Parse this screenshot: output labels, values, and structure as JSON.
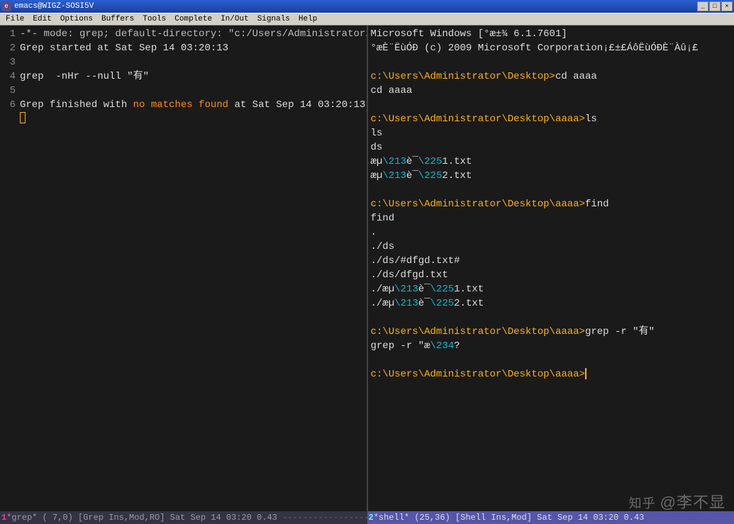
{
  "titlebar": {
    "title": "emacs@WIGZ-SOSI5V"
  },
  "menu": [
    "File",
    "Edit",
    "Options",
    "Buffers",
    "Tools",
    "Complete",
    "In/Out",
    "Signals",
    "Help"
  ],
  "left": {
    "l1": "-*- mode: grep; default-directory: \"c:/Users/Administrator/Desktop/aaaa/\" *",
    "l2": "Grep started at Sat Sep 14 03:20:13",
    "l4": "grep  -nHr --null \"有\"",
    "l6a": "Grep finished with ",
    "l6b": "no matches found",
    "l6c": " at Sat Sep 14 03:20:13"
  },
  "right": {
    "r1": "Microsoft Windows [°æ±¾ 6.1.7601]",
    "r2": "°æÈ¨ËùÓÐ (c) 2009 Microsoft Corporation¡£±£ÁôËùÓÐÈ¨Àû¡£",
    "p1": "c:\\Users\\Administrator\\Desktop>",
    "c1": "cd aaaa",
    "e1": "cd aaaa",
    "p2": "c:\\Users\\Administrator\\Desktop\\aaaa>",
    "c2": "ls",
    "ls1": "ls",
    "ls2": "ds",
    "ls3a": "æµ",
    "ls3b": "\\213",
    "ls3c": "è¯",
    "ls3d": "\\225",
    "ls3e": "1.txt",
    "ls4e": "2.txt",
    "c3": "find",
    "f1": "find",
    "f2": ".",
    "f3": "./ds",
    "f4": "./ds/#dfgd.txt#",
    "f5": "./ds/dfgd.txt",
    "f6a": "./æµ",
    "c4": "grep -r \"有\"",
    "g1a": "grep -r \"æ",
    "g1b": "\\234",
    "g1c": "?"
  },
  "modeline": {
    "left_num": "1",
    "left": "*grep* ( 7,0) [Grep Ins,Mod,RO] Sat Sep 14 03:20 0.43",
    "left_dash": " --------------------------------",
    "right_num": "2",
    "right": "*shell* (25,36) [Shell Ins,Mod] Sat Sep 14 03:20 0.43",
    "right_dash": " -----------------------------"
  },
  "watermark": {
    "logo": "知乎",
    "text": "@李不显"
  }
}
